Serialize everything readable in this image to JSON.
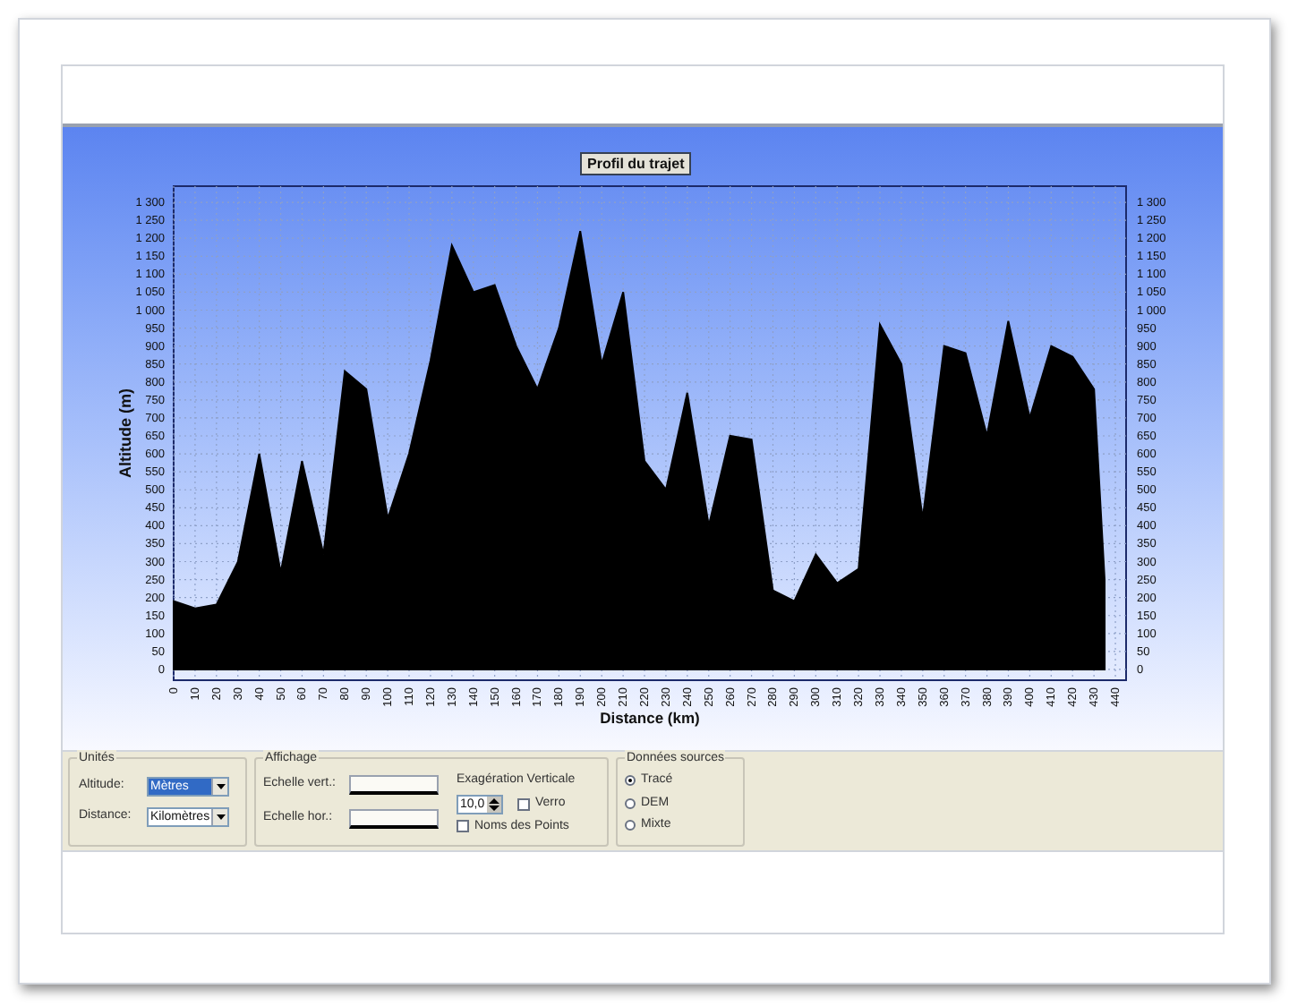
{
  "chart": {
    "chart_data": {
      "type": "area",
      "title": "Profil du trajet",
      "xlabel": "Distance (km)",
      "ylabel": "Altitude (m)",
      "x": [
        0,
        10,
        20,
        30,
        40,
        50,
        60,
        70,
        80,
        90,
        100,
        110,
        120,
        130,
        140,
        150,
        160,
        170,
        180,
        190,
        200,
        210,
        220,
        230,
        240,
        250,
        260,
        270,
        280,
        290,
        300,
        310,
        320,
        330,
        340,
        350,
        360,
        370,
        380,
        390,
        400,
        410,
        420,
        430,
        435
      ],
      "series": [
        {
          "color": "#000000",
          "values": [
            190,
            170,
            180,
            300,
            600,
            270,
            580,
            320,
            830,
            780,
            420,
            600,
            860,
            1180,
            1050,
            1070,
            900,
            780,
            950,
            1220,
            850,
            1050,
            580,
            500,
            770,
            400,
            650,
            640,
            220,
            190,
            320,
            240,
            280,
            960,
            850,
            420,
            900,
            880,
            650,
            970,
            700,
            900,
            870,
            780,
            250
          ]
        }
      ],
      "xlim": [
        0,
        445
      ],
      "ylim": [
        -30,
        1345
      ],
      "xticks": [
        0,
        10,
        20,
        30,
        40,
        50,
        60,
        70,
        80,
        90,
        100,
        110,
        120,
        130,
        140,
        150,
        160,
        170,
        180,
        190,
        200,
        210,
        220,
        230,
        240,
        250,
        260,
        270,
        280,
        290,
        300,
        310,
        320,
        330,
        340,
        350,
        360,
        370,
        380,
        390,
        400,
        410,
        420,
        430,
        440
      ],
      "yticks": [
        0,
        50,
        100,
        150,
        200,
        250,
        300,
        350,
        400,
        450,
        500,
        550,
        600,
        650,
        700,
        750,
        800,
        850,
        900,
        950,
        {
          "value": 1000,
          "label": "1 000"
        },
        {
          "value": 1050,
          "label": "1 050"
        },
        {
          "value": 1100,
          "label": "1 100"
        },
        {
          "value": 1150,
          "label": "1 150"
        },
        {
          "value": 1200,
          "label": "1 200"
        },
        {
          "value": 1250,
          "label": "1 250"
        },
        {
          "value": 1300,
          "label": "1 300"
        }
      ],
      "grid": true
    },
    "right_axis_labels": [
      "1 300",
      "1 250",
      "1 200",
      "1 150",
      "1 100",
      "1 050",
      "1 000",
      "950",
      "900",
      "850",
      "800",
      "750",
      "700",
      "650",
      "600",
      "550",
      "500",
      "450",
      "400",
      "350",
      "300",
      "250",
      "200",
      "150",
      "100",
      "50",
      "0"
    ]
  },
  "units": {
    "title": "Unités",
    "fields": [
      {
        "label": "Altitude:",
        "value": "Mètres",
        "selected": true
      },
      {
        "label": "Distance:",
        "value": "Kilomètres",
        "selected": false
      }
    ]
  },
  "display": {
    "title": "Affichage",
    "scales": [
      {
        "label": "Echelle vert.:"
      },
      {
        "label": "Echelle hor.:"
      }
    ],
    "exaggeration_label": "Exagération Verticale",
    "exaggeration_value": "10,0",
    "checkboxes": [
      {
        "label": "Verro",
        "checked": false
      },
      {
        "label": "Noms des Points",
        "checked": false
      }
    ]
  },
  "sources": {
    "title": "Données sources",
    "options": [
      {
        "label": "Tracé",
        "selected": true
      },
      {
        "label": "DEM",
        "selected": false
      },
      {
        "label": "Mixte",
        "selected": false
      }
    ]
  }
}
